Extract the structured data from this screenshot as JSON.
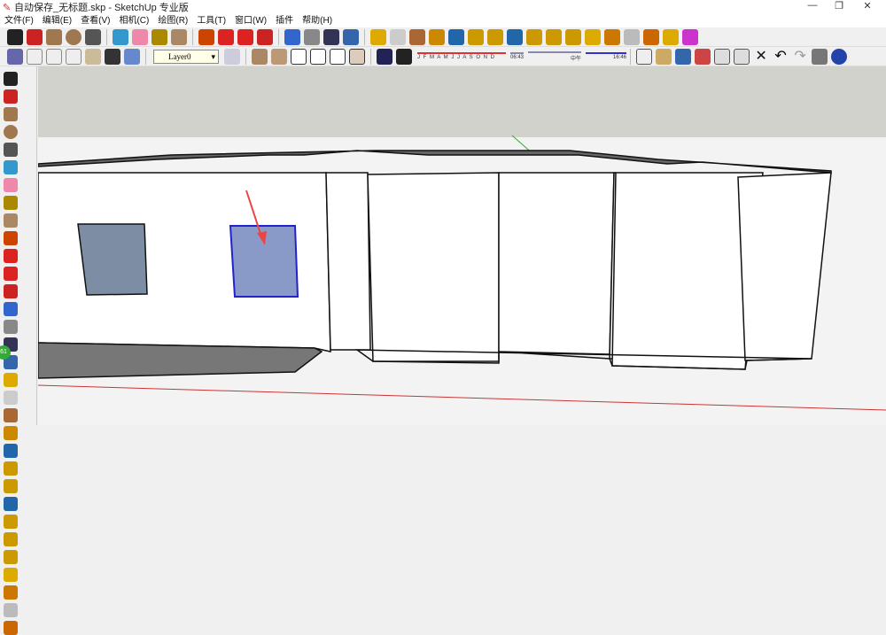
{
  "window": {
    "title": "自动保存_无标题.skp - SketchUp 专业版",
    "minimize": "—",
    "maximize": "❐",
    "close": "✕"
  },
  "menu": [
    "文件(F)",
    "编辑(E)",
    "查看(V)",
    "相机(C)",
    "绘图(R)",
    "工具(T)",
    "窗口(W)",
    "插件",
    "帮助(H)"
  ],
  "toolbar1": {
    "icons": [
      "select",
      "pencil",
      "rectangle",
      "circle",
      "arc",
      "make-component",
      "eraser",
      "tape-measure",
      "paint-bucket",
      "push-pull",
      "move",
      "rotate",
      "follow-me",
      "orbit",
      "pan",
      "zoom",
      "zoom-extents",
      "get-models",
      "share-model",
      "photo-textures",
      "place-model",
      "google-earth",
      "component",
      "dynamic-component",
      "solid-tools",
      "ruby",
      "interact",
      "sandbox",
      "text",
      "axes",
      "section",
      "3d-text",
      "lights",
      "styles"
    ],
    "colors": [
      "#222",
      "#c22",
      "#a07850",
      "#a07850",
      "#555",
      "#39c",
      "#e8a",
      "#a80",
      "#a86",
      "#c40",
      "#d22",
      "#d22",
      "#c22",
      "#36c",
      "#888",
      "#335",
      "#36a",
      "#da0",
      "#ccc",
      "#a63",
      "#c80",
      "#26a",
      "#c90",
      "#c90",
      "#26a",
      "#c90",
      "#c90",
      "#c90",
      "#da0",
      "#c70",
      "#bbb",
      "#c60",
      "#da0",
      "#c3c"
    ]
  },
  "toolbar2": {
    "layer": "Layer0",
    "months": "J F M A M J J A S O N D",
    "time_start": "06:43",
    "time_mid": "中午",
    "time_end": "16:46"
  },
  "left_toolbar": {
    "badge": "61"
  }
}
